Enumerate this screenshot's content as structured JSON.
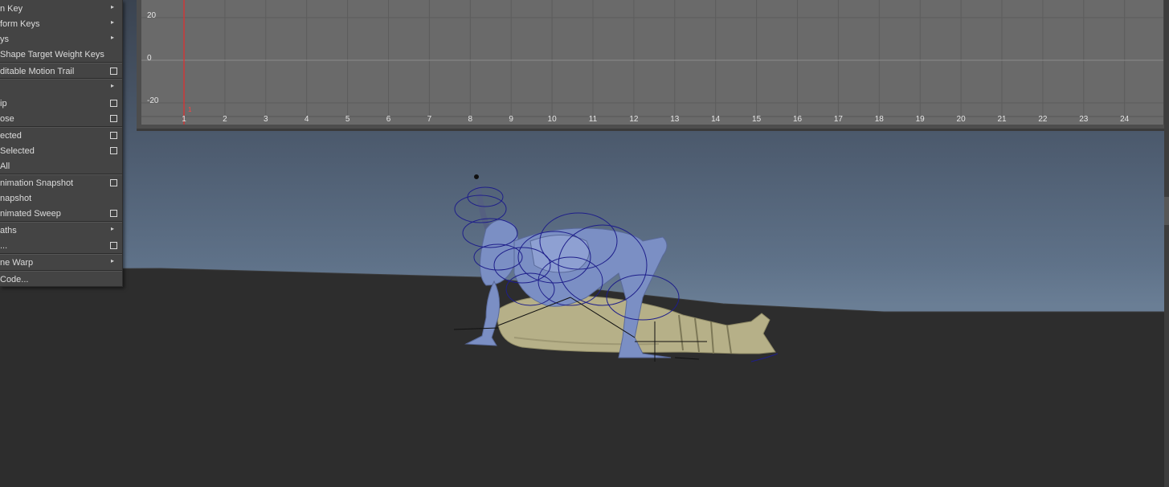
{
  "menu": {
    "items": [
      {
        "label": "n Key",
        "submenu": true,
        "option_box": false
      },
      {
        "label": "form Keys",
        "submenu": true,
        "option_box": false
      },
      {
        "label": "ys",
        "submenu": true,
        "option_box": false
      },
      {
        "label": "Shape Target Weight Keys",
        "submenu": false,
        "option_box": false
      },
      {
        "label": "ditable Motion Trail",
        "submenu": false,
        "option_box": true
      },
      {
        "label": "",
        "submenu": true,
        "option_box": false
      },
      {
        "label": "ip",
        "submenu": false,
        "option_box": true
      },
      {
        "label": "ose",
        "submenu": false,
        "option_box": true
      },
      {
        "label": "ected",
        "submenu": false,
        "option_box": true
      },
      {
        "label": "Selected",
        "submenu": false,
        "option_box": true
      },
      {
        "label": "All",
        "submenu": false,
        "option_box": false
      },
      {
        "label": "nimation Snapshot",
        "submenu": false,
        "option_box": true
      },
      {
        "label": "napshot",
        "submenu": false,
        "option_box": false
      },
      {
        "label": "nimated Sweep",
        "submenu": false,
        "option_box": true
      },
      {
        "label": "aths",
        "submenu": true,
        "option_box": false
      },
      {
        "label": "...",
        "submenu": false,
        "option_box": true
      },
      {
        "label": "ne Warp",
        "submenu": true,
        "option_box": false
      },
      {
        "label": "Code...",
        "submenu": false,
        "option_box": false
      }
    ]
  },
  "graph": {
    "y_labels": [
      "20",
      "0",
      "-20"
    ],
    "x_labels": [
      "1",
      "2",
      "3",
      "4",
      "5",
      "6",
      "7",
      "8",
      "9",
      "10",
      "11",
      "12",
      "13",
      "14",
      "15",
      "16",
      "17",
      "18",
      "19",
      "20",
      "21",
      "22",
      "23",
      "24"
    ],
    "current_frame": "1",
    "current_frame_color": "#ff3b3b"
  },
  "colors": {
    "menu_bg": "#444444",
    "graph_bg": "#6a6a6a",
    "character_blue": "#7b8fc4",
    "body_tan": "#b3ad82",
    "rig_curve": "#1e1e8a"
  }
}
